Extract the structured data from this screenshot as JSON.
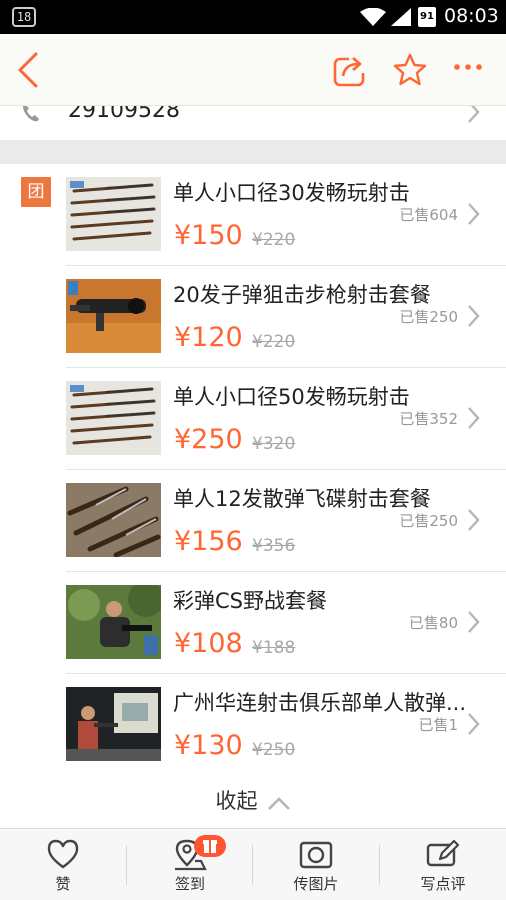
{
  "status_bar": {
    "notification": "18",
    "battery": "91",
    "time": "08:03"
  },
  "shop": {
    "phone": "29109528"
  },
  "deals": {
    "badge": "团",
    "items": [
      {
        "title": "单人小口径30发畅玩射击",
        "price": "¥150",
        "original": "¥220",
        "sold": "已售604"
      },
      {
        "title": "20发子弹狙击步枪射击套餐",
        "price": "¥120",
        "original": "¥220",
        "sold": "已售250"
      },
      {
        "title": "单人小口径50发畅玩射击",
        "price": "¥250",
        "original": "¥320",
        "sold": "已售352"
      },
      {
        "title": "单人12发散弹飞碟射击套餐",
        "price": "¥156",
        "original": "¥356",
        "sold": "已售250"
      },
      {
        "title": "彩弹CS野战套餐",
        "price": "¥108",
        "original": "¥188",
        "sold": "已售80"
      },
      {
        "title": "广州华连射击俱乐部单人散弹...",
        "price": "¥130",
        "original": "¥250",
        "sold": "已售1"
      }
    ],
    "collapse_label": "收起"
  },
  "tab_bar": {
    "like": "赞",
    "checkin": "签到",
    "upload_photo": "传图片",
    "write_review": "写点评"
  },
  "colors": {
    "accent": "#ff6633",
    "badge": "#ee7740"
  },
  "icons": [
    "back-arrow-icon",
    "share-icon",
    "star-icon",
    "more-icon",
    "phone-icon",
    "chevron-right-icon",
    "chevron-up-icon",
    "heart-icon",
    "location-pin-icon",
    "gift-icon",
    "camera-icon",
    "edit-icon"
  ]
}
